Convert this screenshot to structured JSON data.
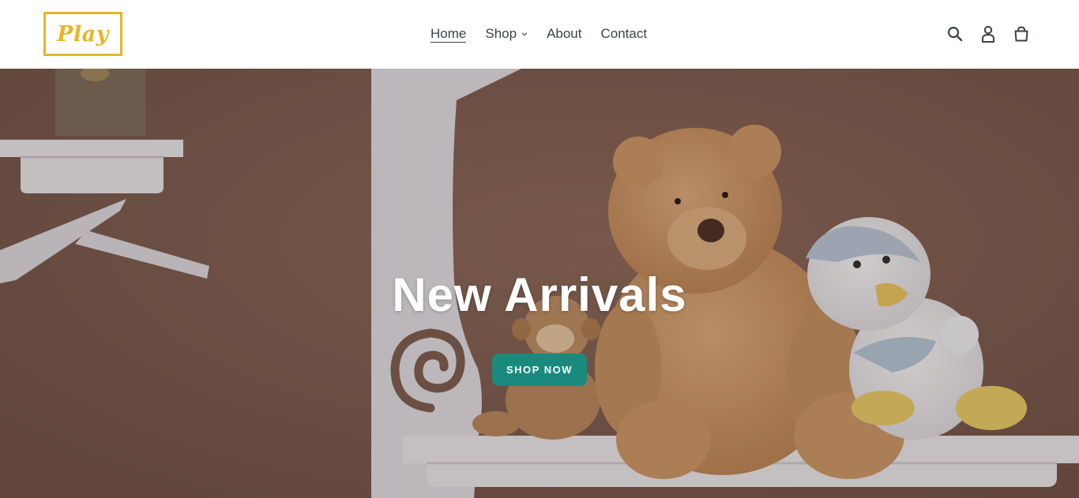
{
  "header": {
    "logo_text": "Play",
    "nav": {
      "home": "Home",
      "shop": "Shop",
      "about": "About",
      "contact": "Contact"
    },
    "icons": [
      "search-icon",
      "account-icon",
      "cart-icon"
    ]
  },
  "hero": {
    "title": "New Arrivals",
    "button_label": "SHOP NOW"
  },
  "colors": {
    "brand_yellow": "#e7b526",
    "button_teal": "#1a8a7e",
    "nav_text": "#3d4246",
    "hero_wall": "#7d5b4e"
  }
}
